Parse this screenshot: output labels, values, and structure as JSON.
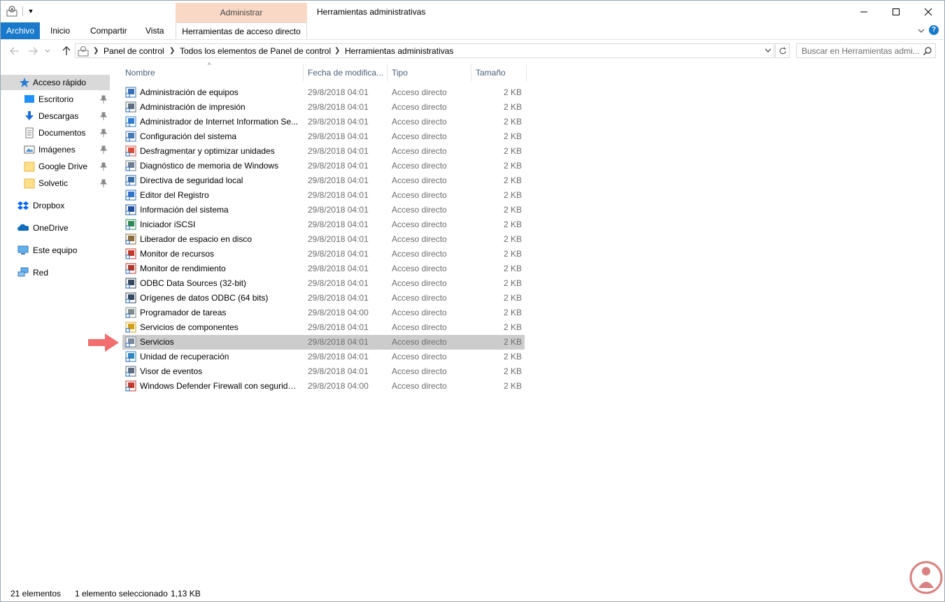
{
  "window": {
    "title": "Herramientas administrativas",
    "contextual_tab_group": "Administrar",
    "controls": [
      "minimize-icon",
      "maximize-icon",
      "close-icon"
    ]
  },
  "ribbon": {
    "tabs": [
      {
        "label": "Archivo",
        "key": "file"
      },
      {
        "label": "Inicio",
        "key": "home"
      },
      {
        "label": "Compartir",
        "key": "share"
      },
      {
        "label": "Vista",
        "key": "view"
      },
      {
        "label": "Herramientas de acceso directo",
        "key": "shortcut-tools",
        "active": true
      }
    ],
    "help_glyph": "?"
  },
  "address_bar": {
    "breadcrumb": [
      "Panel de control",
      "Todos los elementos de Panel de control",
      "Herramientas administrativas"
    ],
    "search_placeholder": "Buscar en Herramientas admi..."
  },
  "nav_pane": {
    "quick_access": {
      "label": "Acceso rápido",
      "selected": true
    },
    "pinned": [
      {
        "label": "Escritorio",
        "icon": "desktop-icon"
      },
      {
        "label": "Descargas",
        "icon": "downloads-icon"
      },
      {
        "label": "Documentos",
        "icon": "documents-icon"
      },
      {
        "label": "Imágenes",
        "icon": "pictures-icon"
      },
      {
        "label": "Google Drive",
        "icon": "folder-icon"
      },
      {
        "label": "Solvetic",
        "icon": "folder-icon"
      }
    ],
    "locations": [
      {
        "label": "Dropbox",
        "icon": "dropbox-icon"
      },
      {
        "label": "OneDrive",
        "icon": "onedrive-icon"
      },
      {
        "label": "Este equipo",
        "icon": "this-pc-icon"
      },
      {
        "label": "Red",
        "icon": "network-icon"
      }
    ]
  },
  "file_list": {
    "columns": {
      "name": "Nombre",
      "date": "Fecha de modifica...",
      "type": "Tipo",
      "size": "Tamaño"
    },
    "sort_indicator": "^",
    "rows": [
      {
        "name": "Administración de equipos",
        "date": "29/8/2018 04:01",
        "type": "Acceso directo",
        "size": "2 KB",
        "icon_color": "#3b6fb6"
      },
      {
        "name": "Administración de impresión",
        "date": "29/8/2018 04:01",
        "type": "Acceso directo",
        "size": "2 KB",
        "icon_color": "#5d6d7e"
      },
      {
        "name": "Administrador de Internet Information Se...",
        "date": "29/8/2018 04:01",
        "type": "Acceso directo",
        "size": "2 KB",
        "icon_color": "#2d7dd2"
      },
      {
        "name": "Configuración del sistema",
        "date": "29/8/2018 04:01",
        "type": "Acceso directo",
        "size": "2 KB",
        "icon_color": "#4a7ab5"
      },
      {
        "name": "Desfragmentar y optimizar unidades",
        "date": "29/8/2018 04:01",
        "type": "Acceso directo",
        "size": "2 KB",
        "icon_color": "#d94f3d"
      },
      {
        "name": "Diagnóstico de memoria de Windows",
        "date": "29/8/2018 04:01",
        "type": "Acceso directo",
        "size": "2 KB",
        "icon_color": "#6b7f8f"
      },
      {
        "name": "Directiva de seguridad local",
        "date": "29/8/2018 04:01",
        "type": "Acceso directo",
        "size": "2 KB",
        "icon_color": "#3a6ea5"
      },
      {
        "name": "Editor del Registro",
        "date": "29/8/2018 04:01",
        "type": "Acceso directo",
        "size": "2 KB",
        "icon_color": "#2f73c9"
      },
      {
        "name": "Información del sistema",
        "date": "29/8/2018 04:01",
        "type": "Acceso directo",
        "size": "2 KB",
        "icon_color": "#214f9e"
      },
      {
        "name": "Iniciador iSCSI",
        "date": "29/8/2018 04:01",
        "type": "Acceso directo",
        "size": "2 KB",
        "icon_color": "#2e8b57"
      },
      {
        "name": "Liberador de espacio en disco",
        "date": "29/8/2018 04:01",
        "type": "Acceso directo",
        "size": "2 KB",
        "icon_color": "#8a6d3b"
      },
      {
        "name": "Monitor de recursos",
        "date": "29/8/2018 04:01",
        "type": "Acceso directo",
        "size": "2 KB",
        "icon_color": "#c0392b"
      },
      {
        "name": "Monitor de rendimiento",
        "date": "29/8/2018 04:01",
        "type": "Acceso directo",
        "size": "2 KB",
        "icon_color": "#b03a2e"
      },
      {
        "name": "ODBC Data Sources (32-bit)",
        "date": "29/8/2018 04:01",
        "type": "Acceso directo",
        "size": "2 KB",
        "icon_color": "#34495e"
      },
      {
        "name": "Orígenes de datos ODBC (64 bits)",
        "date": "29/8/2018 04:01",
        "type": "Acceso directo",
        "size": "2 KB",
        "icon_color": "#34495e"
      },
      {
        "name": "Programador de tareas",
        "date": "29/8/2018 04:00",
        "type": "Acceso directo",
        "size": "2 KB",
        "icon_color": "#7f8c8d"
      },
      {
        "name": "Servicios de componentes",
        "date": "29/8/2018 04:01",
        "type": "Acceso directo",
        "size": "2 KB",
        "icon_color": "#d4a017"
      },
      {
        "name": "Servicios",
        "date": "29/8/2018 04:01",
        "type": "Acceso directo",
        "size": "2 KB",
        "icon_color": "#7a8a99",
        "selected": true
      },
      {
        "name": "Unidad de recuperación",
        "date": "29/8/2018 04:01",
        "type": "Acceso directo",
        "size": "2 KB",
        "icon_color": "#2e86c1"
      },
      {
        "name": "Visor de eventos",
        "date": "29/8/2018 04:01",
        "type": "Acceso directo",
        "size": "2 KB",
        "icon_color": "#5d6d7e"
      },
      {
        "name": "Windows Defender Firewall con segurida...",
        "date": "29/8/2018 04:00",
        "type": "Acceso directo",
        "size": "2 KB",
        "icon_color": "#c0392b"
      }
    ]
  },
  "status_bar": {
    "item_count": "21 elementos",
    "selection": "1 elemento seleccionado",
    "selection_size": "1,13 KB"
  },
  "colors": {
    "file_tab": "#1979ca",
    "contextual_tab": "#f9d9c6",
    "selected_row": "#cccccc",
    "annotation_arrow": "#f26d6d"
  }
}
